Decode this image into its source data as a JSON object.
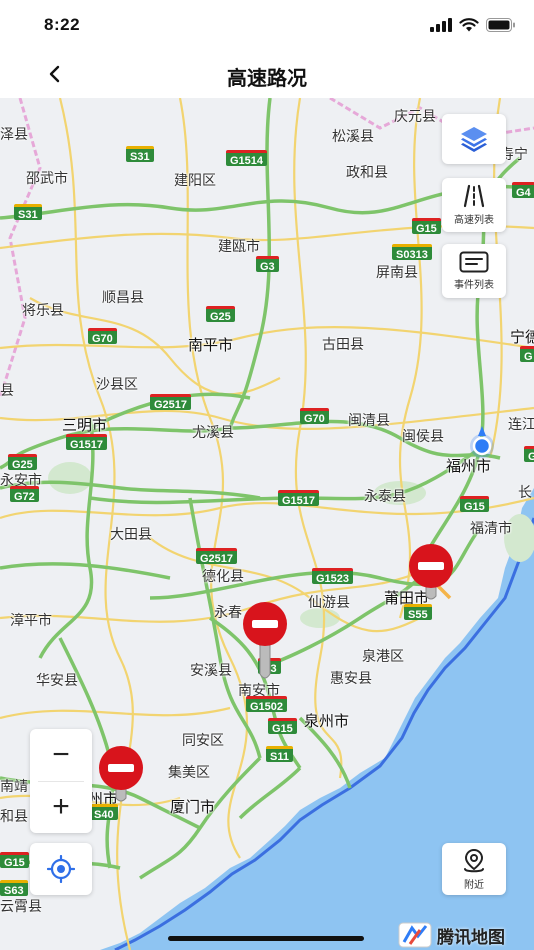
{
  "status": {
    "time": "8:22"
  },
  "nav": {
    "title": "高速路况"
  },
  "tools": {
    "layers": "",
    "highway_list": "高速列表",
    "event_list": "事件列表",
    "nearby": "附近"
  },
  "zoom": {
    "minus": "−",
    "plus": "+"
  },
  "logo": {
    "text": "腾讯地图"
  },
  "places": [
    {
      "name": "泽县"
    },
    {
      "name": "庆元县"
    },
    {
      "name": "松溪县"
    },
    {
      "name": "寿宁"
    },
    {
      "name": "邵武市"
    },
    {
      "name": "建阳区"
    },
    {
      "name": "政和县"
    },
    {
      "name": "建瓯市"
    },
    {
      "name": "屏南县"
    },
    {
      "name": "顺昌县"
    },
    {
      "name": "将乐县"
    },
    {
      "name": "南平市"
    },
    {
      "name": "古田县"
    },
    {
      "name": "宁德"
    },
    {
      "name": "沙县区"
    },
    {
      "name": "三明市"
    },
    {
      "name": "尤溪县"
    },
    {
      "name": "闽清县"
    },
    {
      "name": "连江"
    },
    {
      "name": "闽侯县"
    },
    {
      "name": "福州市"
    },
    {
      "name": "永安市"
    },
    {
      "name": "永泰县"
    },
    {
      "name": "长"
    },
    {
      "name": "福清市"
    },
    {
      "name": "大田县"
    },
    {
      "name": "德化县"
    },
    {
      "name": "仙游县"
    },
    {
      "name": "莆田市"
    },
    {
      "name": "漳平市"
    },
    {
      "name": "永春"
    },
    {
      "name": "泉港区"
    },
    {
      "name": "安溪县"
    },
    {
      "name": "华安县"
    },
    {
      "name": "惠安县"
    },
    {
      "name": "南安市"
    },
    {
      "name": "泉州市"
    },
    {
      "name": "同安区"
    },
    {
      "name": "南靖"
    },
    {
      "name": "集美区"
    },
    {
      "name": "州市"
    },
    {
      "name": "和县"
    },
    {
      "name": "厦门市"
    },
    {
      "name": "云霄县"
    },
    {
      "name": "县"
    }
  ],
  "shields": [
    {
      "code": "S31"
    },
    {
      "code": "G1514"
    },
    {
      "code": "G4"
    },
    {
      "code": "S31"
    },
    {
      "code": "G15"
    },
    {
      "code": "G3"
    },
    {
      "code": "S0313"
    },
    {
      "code": "G25"
    },
    {
      "code": "G70"
    },
    {
      "code": "G2517"
    },
    {
      "code": "G70"
    },
    {
      "code": "G1517"
    },
    {
      "code": "G25"
    },
    {
      "code": "G72"
    },
    {
      "code": "G1517"
    },
    {
      "code": "G15"
    },
    {
      "code": "G2517"
    },
    {
      "code": "G1523"
    },
    {
      "code": "S55"
    },
    {
      "code": "G3"
    },
    {
      "code": "G1502"
    },
    {
      "code": "G15"
    },
    {
      "code": "S11"
    },
    {
      "code": "S40"
    },
    {
      "code": "S63"
    },
    {
      "code": "G15"
    },
    {
      "code": "G"
    },
    {
      "code": "G"
    }
  ]
}
